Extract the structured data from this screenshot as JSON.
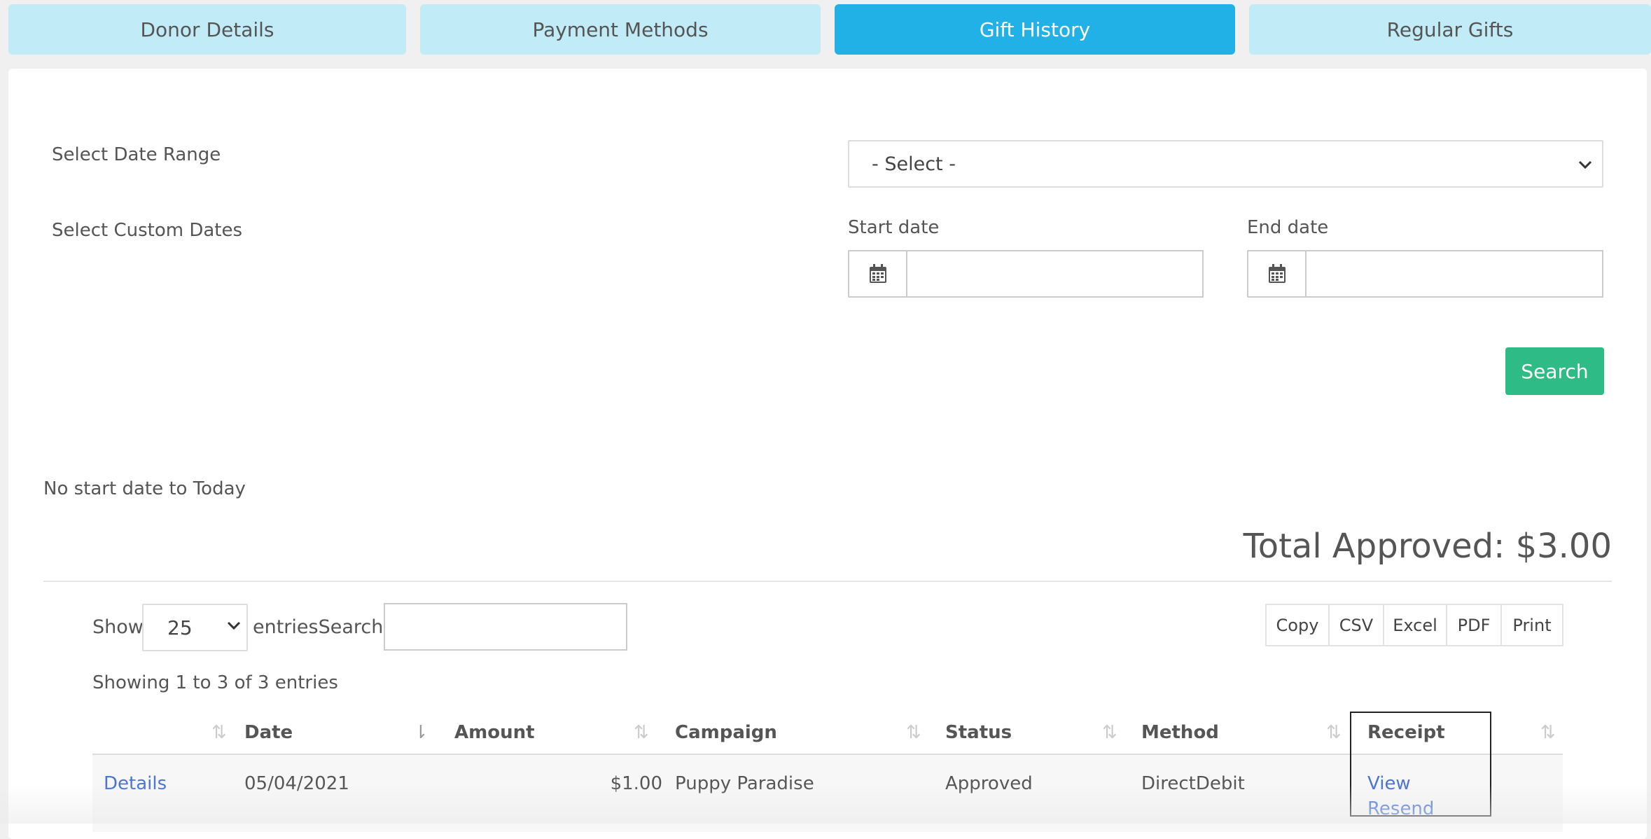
{
  "tabs": [
    {
      "label": "Donor Details"
    },
    {
      "label": "Payment Methods"
    },
    {
      "label": "Gift History",
      "active": true
    },
    {
      "label": "Regular Gifts"
    }
  ],
  "filters": {
    "date_range_label": "Select Date Range",
    "date_range_value": "- Select -",
    "custom_dates_label": "Select Custom Dates",
    "start_date_label": "Start date",
    "start_date_value": "",
    "end_date_label": "End date",
    "end_date_value": "",
    "search_button": "Search"
  },
  "range_summary": "No start date to Today",
  "total": "Total Approved: $3.00",
  "table_controls": {
    "show_label": "Show",
    "page_size": "25",
    "entries_search_label": "entriesSearch:",
    "search_value": "",
    "export_buttons": [
      "Copy",
      "CSV",
      "Excel",
      "PDF",
      "Print"
    ],
    "info": "Showing 1 to 3 of 3 entries"
  },
  "table": {
    "columns": [
      "",
      "Date",
      "Amount",
      "Campaign",
      "Status",
      "Method",
      "Receipt"
    ],
    "rows": [
      {
        "details": "Details",
        "date": "05/04/2021",
        "amount": "$1.00",
        "campaign": "Puppy Paradise",
        "status": "Approved",
        "method": "DirectDebit",
        "receipt_view": "View",
        "receipt_resend": "Resend"
      }
    ]
  },
  "colors": {
    "tab_inactive": "#c2ebf8",
    "tab_active": "#21b1e6",
    "search_button": "#2ebb85",
    "link": "#4a75d6"
  }
}
